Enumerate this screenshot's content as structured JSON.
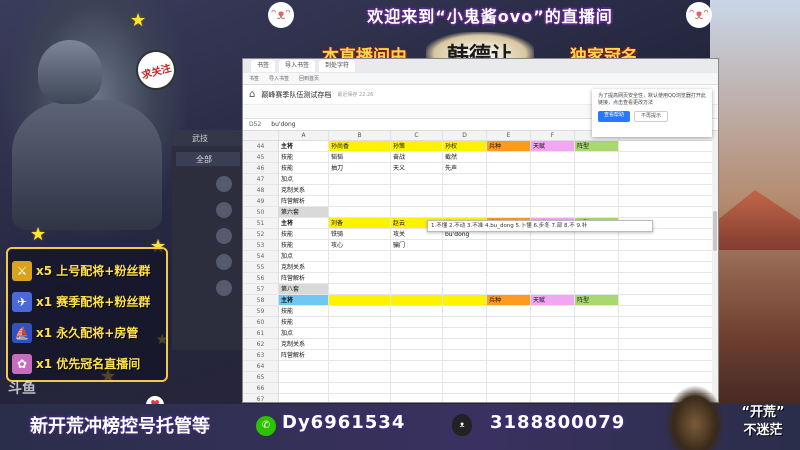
{
  "banner": {
    "title": "欢迎来到“小鬼酱ovo”的直播间",
    "sponsor_left": "本直播间由",
    "sponsor_name": "韩德让",
    "sponsor_right": "独家冠名"
  },
  "follow_bubble": "求关注",
  "perks": [
    {
      "label": "x5 上号配将+粉丝群",
      "icon": "sword-icon",
      "color": "#d8a21c"
    },
    {
      "label": "x1 赛季配将+粉丝群",
      "icon": "rocket-icon",
      "color": "#4a69d6"
    },
    {
      "label": "x1 永久配将+房管",
      "icon": "ship-icon",
      "color": "#3350c2"
    },
    {
      "label": "x1 优先冠名直播间",
      "icon": "lotus-icon",
      "color": "#c76dbf"
    }
  ],
  "game_panel": {
    "header": "武技",
    "tab": "全部"
  },
  "browser": {
    "tabs": [
      "书签",
      "导入书签",
      "到处字符"
    ],
    "bookmarks": [
      "书签",
      "导入书签",
      "回到首页"
    ],
    "doc_title": "巅峰赛季队伍测试存档",
    "doc_sub": "最近保存 22:26",
    "cell_ref": "D52",
    "formula": "bu'dong",
    "popup": {
      "text": "为了提高网页安全性，默认使用QQ浏览器打开此链接，点击查看更改方法",
      "ok": "查看帮助",
      "no": "不再提示"
    },
    "columns": [
      "",
      "A",
      "B",
      "C",
      "D",
      "E",
      "F",
      "G"
    ],
    "autocomplete": "1.不懂  2.不动  3.不准  4.bu_dong  5.卜懂  6.步冬  7.部  8.不  9.补",
    "rows": [
      {
        "n": "44",
        "cells": [
          "主将",
          "孙尚香",
          "孙策",
          "孙权",
          "兵种",
          "天赋",
          "阵型"
        ],
        "style": [
          "bold",
          "y",
          "y",
          "y",
          "o",
          "p",
          "g"
        ]
      },
      {
        "n": "45",
        "cells": [
          "技能",
          "韬韬",
          "奋战",
          "截然",
          "",
          "",
          ""
        ]
      },
      {
        "n": "46",
        "cells": [
          "技能",
          "抽刀",
          "天义",
          "先声",
          "",
          "",
          ""
        ]
      },
      {
        "n": "47",
        "cells": [
          "加点",
          "",
          "",
          "",
          "",
          "",
          ""
        ]
      },
      {
        "n": "48",
        "cells": [
          "克制关系",
          "",
          "",
          "",
          "",
          "",
          ""
        ]
      },
      {
        "n": "49",
        "cells": [
          "阵营解析",
          "",
          "",
          "",
          "",
          "",
          ""
        ]
      },
      {
        "n": "50",
        "cells": [
          "第六套",
          "",
          "",
          "",
          "",
          "",
          ""
        ],
        "style": [
          "gr",
          "",
          "",
          "",
          "",
          "",
          ""
        ]
      },
      {
        "n": "51",
        "cells": [
          "主将",
          "刘备",
          "赵云",
          "关羽",
          "兵种",
          "天赋",
          "阵型"
        ],
        "style": [
          "bold",
          "y",
          "y",
          "y",
          "o",
          "p",
          "g"
        ]
      },
      {
        "n": "52",
        "cells": [
          "技能",
          "铁骑",
          "攻关",
          "bu'dong",
          "",
          "",
          ""
        ]
      },
      {
        "n": "53",
        "cells": [
          "技能",
          "攻心",
          "骗门",
          "",
          "",
          "",
          ""
        ]
      },
      {
        "n": "54",
        "cells": [
          "加点",
          "",
          "",
          "",
          "",
          "",
          ""
        ]
      },
      {
        "n": "55",
        "cells": [
          "克制关系",
          "",
          "",
          "",
          "",
          "",
          ""
        ]
      },
      {
        "n": "56",
        "cells": [
          "阵营解析",
          "",
          "",
          "",
          "",
          "",
          ""
        ]
      },
      {
        "n": "57",
        "cells": [
          "第八套",
          "",
          "",
          "",
          "",
          "",
          ""
        ],
        "style": [
          "gr",
          "",
          "",
          "",
          "",
          "",
          ""
        ]
      },
      {
        "n": "58",
        "cells": [
          "主将",
          "",
          "",
          "",
          "兵种",
          "天赋",
          "阵型"
        ],
        "style": [
          "bold b",
          "y",
          "y",
          "y",
          "o",
          "p",
          "g"
        ]
      },
      {
        "n": "59",
        "cells": [
          "技能",
          "",
          "",
          "",
          "",
          "",
          ""
        ]
      },
      {
        "n": "60",
        "cells": [
          "技能",
          "",
          "",
          "",
          "",
          "",
          ""
        ]
      },
      {
        "n": "61",
        "cells": [
          "加点",
          "",
          "",
          "",
          "",
          "",
          ""
        ]
      },
      {
        "n": "62",
        "cells": [
          "克制关系",
          "",
          "",
          "",
          "",
          "",
          ""
        ]
      },
      {
        "n": "63",
        "cells": [
          "阵营解析",
          "",
          "",
          "",
          "",
          "",
          ""
        ]
      },
      {
        "n": "64",
        "cells": [
          "",
          "",
          "",
          "",
          "",
          "",
          ""
        ]
      },
      {
        "n": "65",
        "cells": [
          "",
          "",
          "",
          "",
          "",
          "",
          ""
        ]
      },
      {
        "n": "66",
        "cells": [
          "",
          "",
          "",
          "",
          "",
          "",
          ""
        ]
      },
      {
        "n": "67",
        "cells": [
          "",
          "",
          "",
          "",
          "",
          "",
          ""
        ]
      }
    ]
  },
  "bottom": {
    "left": "新开荒冲榜控号托管等",
    "wechat": "Dy6961534",
    "qq": "3188800079",
    "right_line1": "“开荒”",
    "right_line2": "不迷茫"
  },
  "watermark": "斗鱼",
  "watermark_id": "6961534"
}
